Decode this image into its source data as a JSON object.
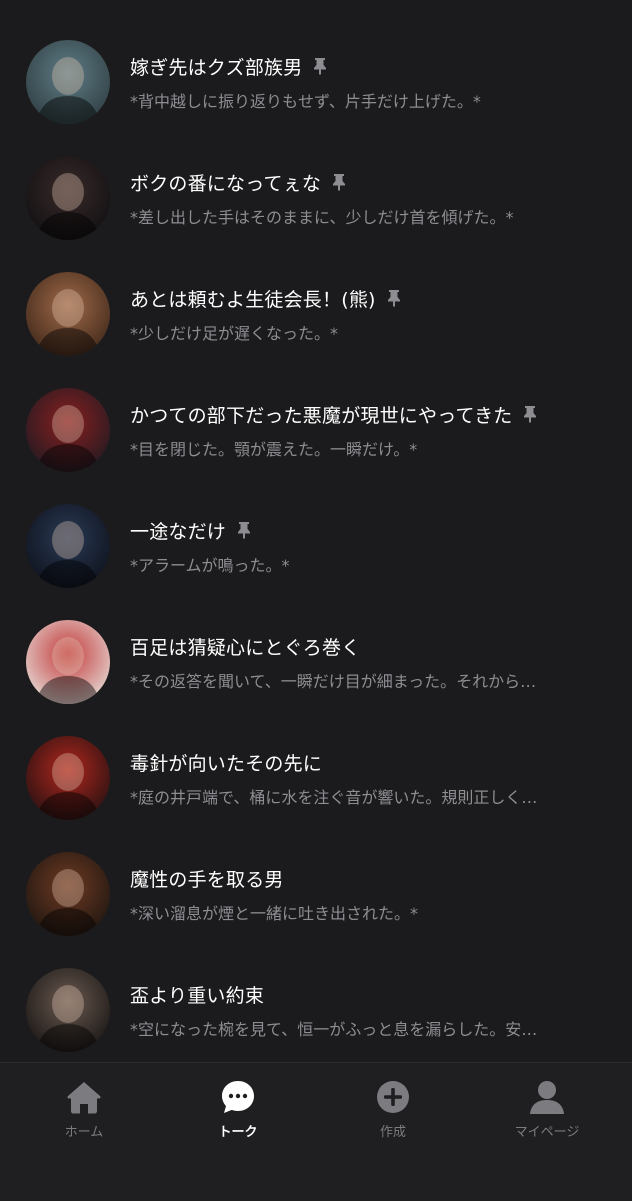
{
  "chats": [
    {
      "title": "嫁ぎ先はクズ部族男",
      "preview": "*背中越しに振り返りもせず、片手だけ上げた。*",
      "pinned": true,
      "avatar_icon": "character-avatar-icon",
      "avatar_colors": [
        "#5f7d86",
        "#2c3a3e"
      ]
    },
    {
      "title": "ボクの番になってぇな",
      "preview": "*差し出した手はそのままに、少しだけ首を傾げた。*",
      "pinned": true,
      "avatar_icon": "character-avatar-icon",
      "avatar_colors": [
        "#3a2a2a",
        "#0e0e10"
      ]
    },
    {
      "title": "あとは頼むよ生徒会長！(熊)",
      "preview": "*少しだけ足が遅くなった。*",
      "pinned": true,
      "avatar_icon": "character-avatar-icon",
      "avatar_colors": [
        "#a06a48",
        "#3a2418"
      ]
    },
    {
      "title": "かつての部下だった悪魔が現世にやってきた",
      "preview": "*目を閉じた。顎が震えた。一瞬だけ。*",
      "pinned": true,
      "avatar_icon": "character-avatar-icon",
      "avatar_colors": [
        "#8a1f1f",
        "#1a1a22"
      ]
    },
    {
      "title": "一途なだけ",
      "preview": "*アラームが鳴った。*",
      "pinned": true,
      "avatar_icon": "character-avatar-icon",
      "avatar_colors": [
        "#2a3a55",
        "#0c0f18"
      ]
    },
    {
      "title": "百足は猜疑心にとぐろ巻く",
      "preview": "*その返答を聞いて、一瞬だけ目が細まった。それから…",
      "pinned": false,
      "avatar_icon": "character-avatar-icon",
      "avatar_colors": [
        "#c23a3a",
        "#e8e4e0"
      ]
    },
    {
      "title": "毒針が向いたその先に",
      "preview": "*庭の井戸端で、桶に水を注ぐ音が響いた。規則正しく…",
      "pinned": false,
      "avatar_icon": "character-avatar-icon",
      "avatar_colors": [
        "#b3261e",
        "#1c1010"
      ]
    },
    {
      "title": "魔性の手を取る男",
      "preview": "*深い溜息が煙と一緒に吐き出された。*",
      "pinned": false,
      "avatar_icon": "character-avatar-icon",
      "avatar_colors": [
        "#6e3a22",
        "#1a1410"
      ]
    },
    {
      "title": "盃より重い約束",
      "preview": "*空になった椀を見て、恒一がふっと息を漏らした。安…",
      "pinned": false,
      "avatar_icon": "character-avatar-icon",
      "avatar_colors": [
        "#6b5a50",
        "#141212"
      ]
    }
  ],
  "nav": [
    {
      "label": "ホーム",
      "icon": "home-icon",
      "active": false
    },
    {
      "label": "トーク",
      "icon": "chat-bubble-icon",
      "active": true
    },
    {
      "label": "作成",
      "icon": "plus-circle-icon",
      "active": false
    },
    {
      "label": "マイページ",
      "icon": "person-icon",
      "active": false
    }
  ],
  "colors": {
    "background": "#1b1b1d",
    "nav_background": "#1f1f21",
    "title_text": "#ffffff",
    "preview_text": "#8d8d92",
    "pin_icon": "#8d8d92",
    "nav_inactive": "#7b7b80",
    "nav_active": "#ffffff"
  }
}
